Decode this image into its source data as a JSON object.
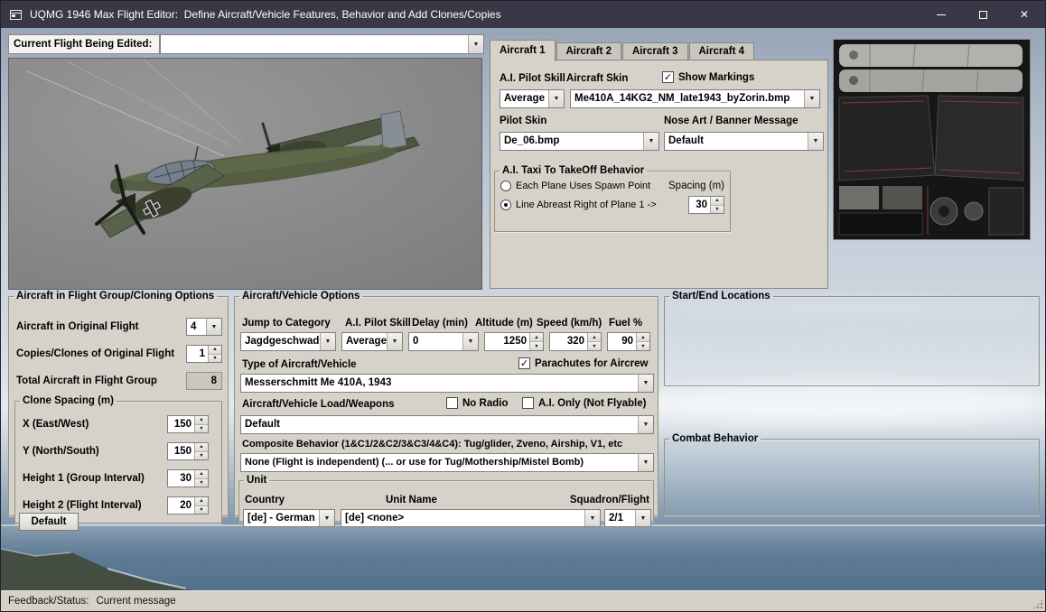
{
  "colors": {
    "titlebar": "#3a3847",
    "panel": "#d6d2ca",
    "sky": "#bdc7d4",
    "sea": "#5d7a96"
  },
  "icons": {
    "dropdown": "▼",
    "spin_up": "▲",
    "spin_down": "▼",
    "close": "✕"
  },
  "window": {
    "title": "UQMG 1946 Max Flight Editor:  Define Aircraft/Vehicle Features, Behavior and Add Clones/Copies"
  },
  "current_flight": {
    "label": "Current Flight Being Edited:",
    "value": ""
  },
  "tabs": {
    "items": [
      "Aircraft 1",
      "Aircraft 2",
      "Aircraft 3",
      "Aircraft 4"
    ],
    "active": "Aircraft 1"
  },
  "aircraft1": {
    "pilot_skill_label": "A.I. Pilot Skill",
    "aircraft_skin_label": "Aircraft Skin",
    "show_markings": {
      "label": "Show Markings",
      "checked": true
    },
    "pilot_skill_value": "Average",
    "aircraft_skin_value": "Me410A_14KG2_NM_late1943_byZorin.bmp",
    "pilot_skin_label": "Pilot Skin",
    "nose_art_label": "Nose Art / Banner Message",
    "pilot_skin_value": "De_06.bmp",
    "nose_art_value": "Default",
    "taxi": {
      "title": "A.I. Taxi To TakeOff Behavior",
      "spawn_option": {
        "label": "Each Plane Uses Spawn Point",
        "selected": false
      },
      "spacing_label": "Spacing (m)",
      "line_abreast_option": {
        "label": "Line Abreast Right of Plane 1 ->",
        "selected": true
      },
      "spacing_value": "30"
    }
  },
  "cloning": {
    "title": "Aircraft in Flight Group/Cloning Options",
    "original_label": "Aircraft in Original Flight",
    "original_value": "4",
    "copies_label": "Copies/Clones of Original Flight",
    "copies_value": "1",
    "total_label": "Total Aircraft in Flight Group",
    "total_value": "8",
    "spacing": {
      "title": "Clone Spacing (m)",
      "x_label": "X (East/West)",
      "x_value": "150",
      "y_label": "Y (North/South)",
      "y_value": "150",
      "h1_label": "Height 1 (Group Interval)",
      "h1_value": "30",
      "h2_label": "Height 2 (Flight Interval)",
      "h2_value": "20",
      "default_button": "Default"
    }
  },
  "options": {
    "title": "Aircraft/Vehicle Options",
    "jump_label": "Jump to Category",
    "jump_value": "Jagdgeschwad",
    "skill_label": "A.I. Pilot Skill",
    "skill_value": "Average",
    "delay_label": "Delay (min)",
    "delay_value": "0",
    "altitude_label": "Altitude (m)",
    "altitude_value": "1250",
    "speed_label": "Speed (km/h)",
    "speed_value": "320",
    "fuel_label": "Fuel %",
    "fuel_value": "90",
    "type_label": "Type of Aircraft/Vehicle",
    "parachutes": {
      "label": "Parachutes for Aircrew",
      "checked": true
    },
    "type_value": "Messerschmitt Me 410A, 1943",
    "load_label": "Aircraft/Vehicle Load/Weapons",
    "no_radio": {
      "label": "No Radio",
      "checked": false
    },
    "ai_only": {
      "label": "A.I. Only (Not Flyable)",
      "checked": false
    },
    "load_value": "Default",
    "composite_label": "Composite Behavior (1&C1/2&C2/3&C3/4&C4): Tug/glider, Zveno, Airship, V1, etc",
    "composite_value": "None (Flight is independent) (... or use for Tug/Mothership/Mistel Bomb)",
    "unit": {
      "title": "Unit",
      "country_label": "Country",
      "country_value": "[de] - German",
      "name_label": "Unit Name",
      "name_value": "[de] <none>",
      "squadron_label": "Squadron/Flight",
      "squadron_value": "2/1"
    }
  },
  "start_end_title": "Start/End Locations",
  "combat_title": "Combat Behavior",
  "status": {
    "label": "Feedback/Status:",
    "message": "Current message"
  }
}
